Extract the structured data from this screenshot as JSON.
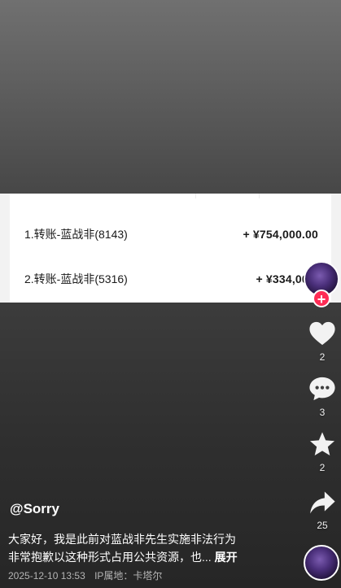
{
  "transfers": [
    {
      "label": "1.转账-蓝战非(8143)",
      "amount": "+ ¥754,000.00"
    },
    {
      "label": "2.转账-蓝战非(5316)",
      "amount": "+ ¥334,000."
    }
  ],
  "actions": {
    "like_count": "2",
    "comment_count": "3",
    "favorite_count": "2",
    "share_count": "25",
    "follow_symbol": "+"
  },
  "post": {
    "author": "@Sorry",
    "caption_line1": "大家好，我是此前对蓝战非先生实施非法行为",
    "caption_line2": "非常抱歉以这种形式占用公共资源，也...",
    "expand_label": "展开",
    "datetime": "2025-12-10 13:53",
    "ip_location": "IP属地：卡塔尔"
  },
  "colors": {
    "accent": "#fe2c55",
    "text_light": "#ffffff",
    "meta_gray": "#b5b5b5"
  },
  "icons": [
    "heart-icon",
    "comment-icon",
    "star-icon",
    "share-icon",
    "plus-icon"
  ]
}
